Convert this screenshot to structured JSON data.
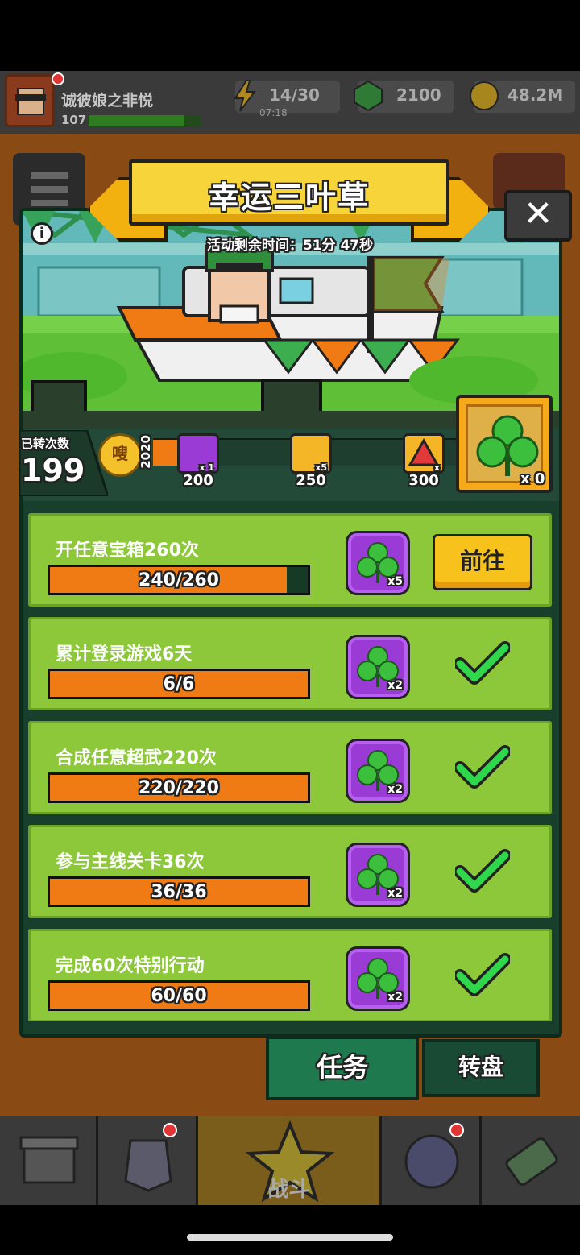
{
  "topbar": {
    "player_name": "诚彼娘之非悦",
    "player_level": "107",
    "energy": "14/30",
    "energy_timer": "07:18",
    "gems": "2100",
    "coins": "48.2M"
  },
  "popup": {
    "title": "幸运三叶草",
    "close_label": "✕",
    "info_label": "i",
    "timer_text": "活动剩余时间：51分 47秒",
    "spin_label": "已转次数",
    "spin_count": "199",
    "year": "2020",
    "coin_label": "嗖",
    "milestones": [
      {
        "value": "200",
        "badge": "x 1"
      },
      {
        "value": "250",
        "badge": "x5"
      },
      {
        "value": "300",
        "badge": "x"
      }
    ],
    "big_reward_count": "x 0"
  },
  "tasks": [
    {
      "title": "开任意宝箱260次",
      "progress": "240/260",
      "fraction": 0.923,
      "reward_qty": "x5",
      "status": "go",
      "button_label": "前往"
    },
    {
      "title": "累计登录游戏6天",
      "progress": "6/6",
      "fraction": 1.0,
      "reward_qty": "x2",
      "status": "done"
    },
    {
      "title": "合成任意超武220次",
      "progress": "220/220",
      "fraction": 1.0,
      "reward_qty": "x2",
      "status": "done"
    },
    {
      "title": "参与主线关卡36次",
      "progress": "36/36",
      "fraction": 1.0,
      "reward_qty": "x2",
      "status": "done"
    },
    {
      "title": "完成60次特别行动",
      "progress": "60/60",
      "fraction": 1.0,
      "reward_qty": "x2",
      "status": "done"
    }
  ],
  "tabs": {
    "task": "任务",
    "wheel": "转盘"
  },
  "nav": {
    "battle": "战斗"
  },
  "colors": {
    "orange_fill": "#f07b14",
    "task_green": "#8cc83a",
    "reward_purple": "#9b3bd6",
    "banner_yellow": "#f7d43a"
  }
}
